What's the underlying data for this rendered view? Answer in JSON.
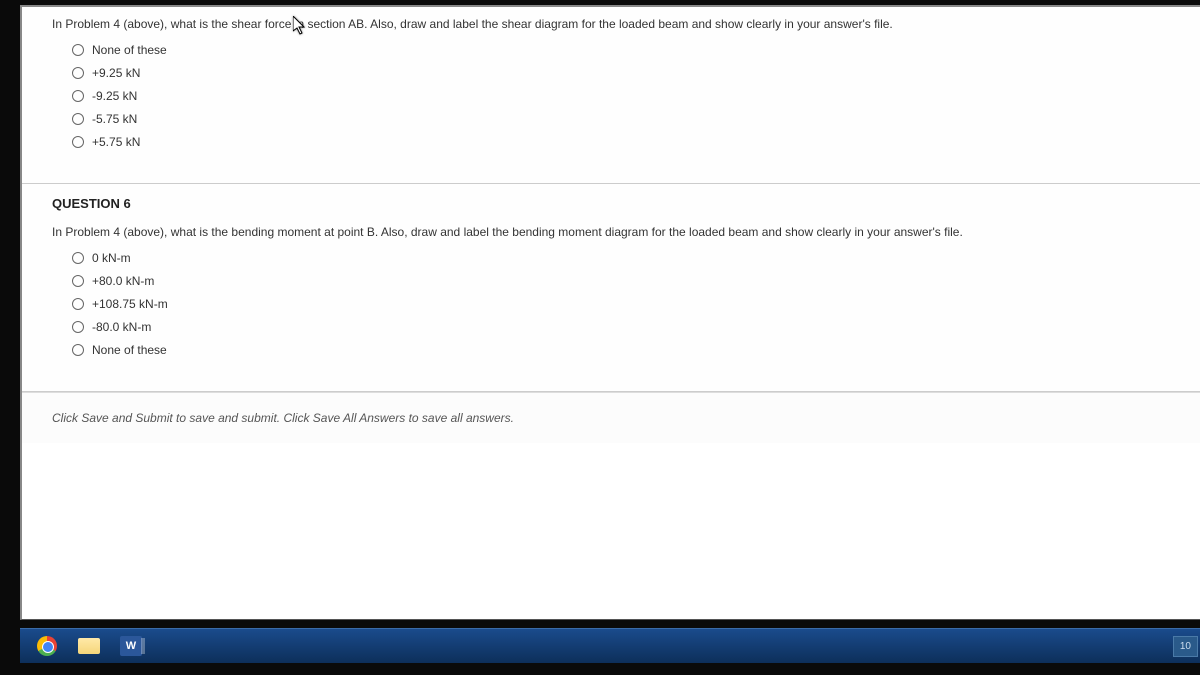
{
  "question5": {
    "text": "In Problem 4 (above), what is the shear force in section AB. Also, draw and label the shear diagram for the loaded beam and show clearly in your answer's file.",
    "options": [
      "None of these",
      "+9.25 kN",
      "-9.25 kN",
      "-5.75 kN",
      "+5.75 kN"
    ]
  },
  "question6": {
    "title": "QUESTION 6",
    "text": "In Problem 4 (above), what is the bending moment at point B. Also, draw and label the bending moment diagram for the loaded beam and show clearly in your answer's file.",
    "options": [
      "0 kN-m",
      "+80.0 kN-m",
      "+108.75 kN-m",
      "-80.0 kN-m",
      "None of these"
    ]
  },
  "instruction": "Click Save and Submit to save and submit. Click Save All Answers to save all answers.",
  "word_letter": "W",
  "tray_value": "10"
}
